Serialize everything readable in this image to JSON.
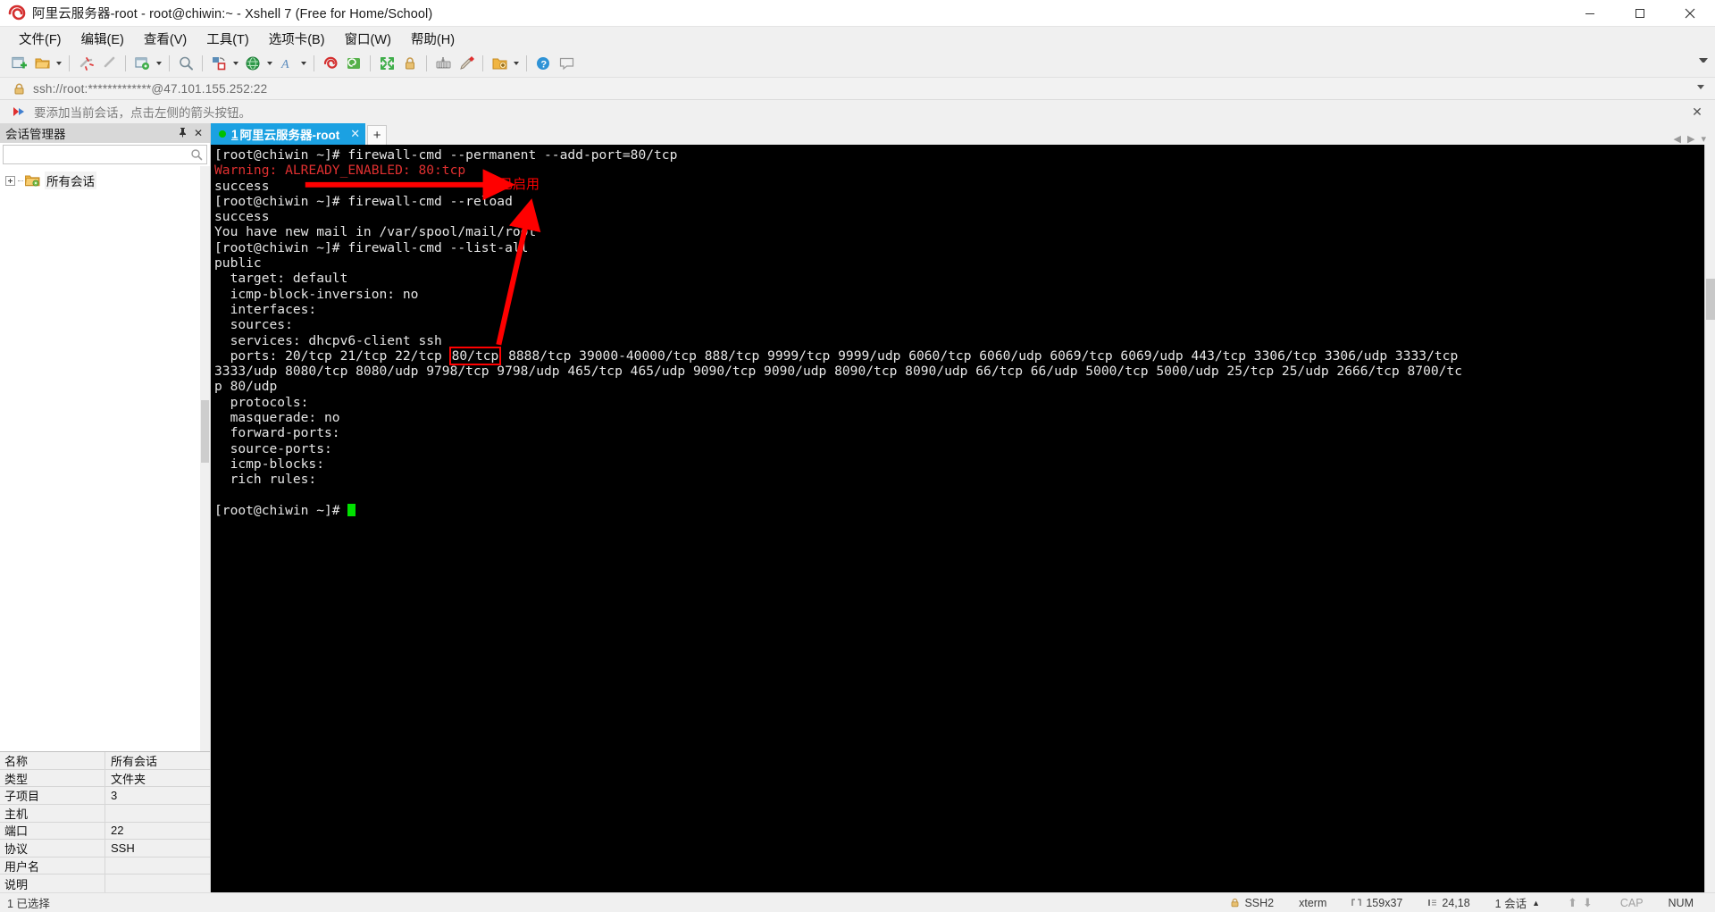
{
  "window": {
    "title": "阿里云服务器-root - root@chiwin:~ - Xshell 7 (Free for Home/School)",
    "logo_icon": "xshell-logo-icon",
    "minimize_label": "最小化",
    "maximize_label": "最大化",
    "close_label": "关闭"
  },
  "menu": {
    "items": [
      {
        "label": "文件(F)",
        "name": "menu-file"
      },
      {
        "label": "编辑(E)",
        "name": "menu-edit"
      },
      {
        "label": "查看(V)",
        "name": "menu-view"
      },
      {
        "label": "工具(T)",
        "name": "menu-tools"
      },
      {
        "label": "选项卡(B)",
        "name": "menu-tab"
      },
      {
        "label": "窗口(W)",
        "name": "menu-window"
      },
      {
        "label": "帮助(H)",
        "name": "menu-help"
      }
    ]
  },
  "toolbar": {
    "buttons": [
      {
        "icon": "new-session-icon"
      },
      {
        "icon": "open-folder-icon"
      },
      {
        "icon": "disconnect-icon"
      },
      {
        "icon": "reconnect-icon"
      },
      {
        "icon": "session-properties-icon"
      },
      {
        "icon": "find-icon"
      },
      {
        "icon": "file-transfer-icon"
      },
      {
        "icon": "globe-icon"
      },
      {
        "icon": "font-size-icon"
      },
      {
        "icon": "xshell-icon"
      },
      {
        "icon": "xftp-icon"
      },
      {
        "icon": "fullscreen-icon"
      },
      {
        "icon": "lock-icon"
      },
      {
        "icon": "keyboard-icon"
      },
      {
        "icon": "highlight-pen-icon"
      },
      {
        "icon": "add-to-folder-icon"
      }
    ],
    "overflow_icon": "toolbar-overflow-icon"
  },
  "address_bar": {
    "lock_icon": "address-lock-icon",
    "url": "ssh://root:*************@47.101.155.252:22",
    "dropdown_icon": "chevron-down-icon"
  },
  "notice_bar": {
    "icon": "add-session-arrow-icon",
    "text": "要添加当前会话，点击左侧的箭头按钮。",
    "close_label": "✕"
  },
  "session_panel": {
    "title": "会话管理器",
    "pin_label": "⇱",
    "close_label": "✕",
    "search_placeholder": "",
    "search_value": "",
    "search_icon": "search-icon",
    "tree": [
      {
        "label": "所有会话",
        "icon": "folder-session-icon",
        "expanded": false
      }
    ],
    "properties": {
      "rows": [
        {
          "key": "名称",
          "value": "所有会话"
        },
        {
          "key": "类型",
          "value": "文件夹"
        },
        {
          "key": "子项目",
          "value": "3"
        },
        {
          "key": "主机",
          "value": ""
        },
        {
          "key": "端口",
          "value": "22"
        },
        {
          "key": "协议",
          "value": "SSH"
        },
        {
          "key": "用户名",
          "value": ""
        },
        {
          "key": "说明",
          "value": ""
        }
      ]
    }
  },
  "tabs": {
    "items": [
      {
        "number": "1",
        "label": "阿里云服务器-root",
        "active": true,
        "status_icon": "connected-dot-icon",
        "close_label": "✕"
      }
    ],
    "new_tab_label": "+",
    "nav_prev": "◀",
    "nav_next": "▶",
    "nav_menu": "▾"
  },
  "terminal": {
    "lines": [
      {
        "type": "plain",
        "text": "[root@chiwin ~]# firewall-cmd --permanent --add-port=80/tcp"
      },
      {
        "type": "warn",
        "text": "Warning: ALREADY_ENABLED: 80:tcp"
      },
      {
        "type": "plain",
        "text": "success"
      },
      {
        "type": "plain",
        "text": "[root@chiwin ~]# firewall-cmd --reload"
      },
      {
        "type": "plain",
        "text": "success"
      },
      {
        "type": "plain",
        "text": "You have new mail in /var/spool/mail/root"
      },
      {
        "type": "plain",
        "text": "[root@chiwin ~]# firewall-cmd --list-all"
      },
      {
        "type": "plain",
        "text": "public"
      },
      {
        "type": "plain",
        "text": "  target: default"
      },
      {
        "type": "plain",
        "text": "  icmp-block-inversion: no"
      },
      {
        "type": "plain",
        "text": "  interfaces:"
      },
      {
        "type": "plain",
        "text": "  sources:"
      },
      {
        "type": "plain",
        "text": "  services: dhcpv6-client ssh"
      }
    ],
    "ports_line": {
      "prefix": "  ports: 20/tcp 21/tcp 22/tcp ",
      "highlight": "80/tcp",
      "suffix": " 8888/tcp 39000-40000/tcp 888/tcp 9999/tcp 9999/udp 6060/tcp 6060/udp 6069/tcp 6069/udp 443/tcp 3306/tcp 3306/udp 3333/tcp"
    },
    "ports_wrap_lines": [
      "3333/udp 8080/tcp 8080/udp 9798/tcp 9798/udp 465/tcp 465/udp 9090/tcp 9090/udp 8090/tcp 8090/udp 66/tcp 66/udp 5000/tcp 5000/udp 25/tcp 25/udp 2666/tcp 8700/tc",
      "p 80/udp"
    ],
    "tail_lines": [
      "  protocols:",
      "  masquerade: no",
      "  forward-ports:",
      "  source-ports:",
      "  icmp-blocks:",
      "  rich rules:",
      "",
      "[root@chiwin ~]# "
    ],
    "annotation": {
      "label": "已启用",
      "arrow_color": "#ff0000",
      "label_color": "#ff0000"
    },
    "colors": {
      "background": "#000000",
      "foreground": "#e6e6e6",
      "warning": "#e03030",
      "cursor": "#00e000",
      "highlight_box": "#ff0000"
    }
  },
  "status_bar": {
    "left": "1 已选择",
    "lock_icon": "ssh-lock-icon",
    "protocol": "SSH2",
    "terminal_type": "xterm",
    "size_icon": "term-size-icon",
    "size": "159x37",
    "cursor_icon": "cursor-pos-icon",
    "cursor_pos": "24,18",
    "sessions": "1 会话",
    "sessions_caret": "▲",
    "up_icon": "arrow-up-icon",
    "down_icon": "arrow-down-icon",
    "cap": "CAP",
    "num": "NUM"
  }
}
